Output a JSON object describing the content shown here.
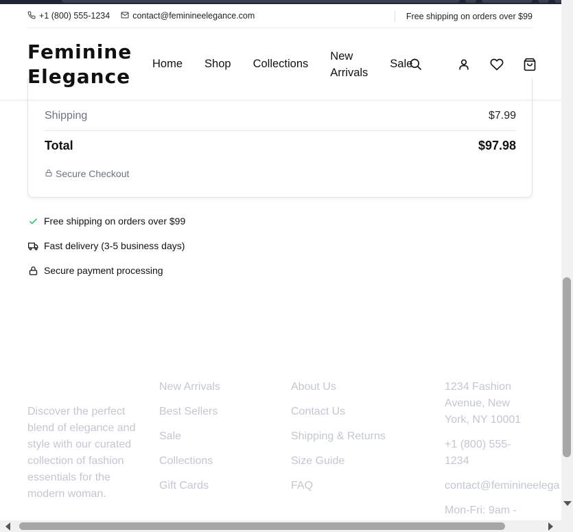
{
  "topbar": {
    "phone": "+1 (800) 555-1234",
    "email": "contact@feminineelegance.com",
    "promo": "Free shipping on orders over $99"
  },
  "header": {
    "logo_line1": "Feminine",
    "logo_line2": "Elegance",
    "nav": {
      "home": "Home",
      "shop": "Shop",
      "collections": "Collections",
      "new_line1": "New",
      "new_line2": "Arrivals",
      "sale": "Sale"
    },
    "icons": [
      "search-icon",
      "user-icon",
      "heart-icon",
      "cart-icon"
    ]
  },
  "summary": {
    "shipping_label": "Shipping",
    "shipping_value": "$7.99",
    "total_label": "Total",
    "total_value": "$97.98",
    "secure_label": "Secure Checkout"
  },
  "benefits": [
    {
      "icon": "check-icon",
      "text": "Free shipping on orders over $99"
    },
    {
      "icon": "truck-icon",
      "text": "Fast delivery (3-5 business days)"
    },
    {
      "icon": "lock-icon",
      "text": "Secure payment processing"
    }
  ],
  "footer": {
    "about": "Discover the perfect blend of elegance and style with our curated collection of fashion essentials for the modern woman.",
    "shop_links": [
      "New Arrivals",
      "Best Sellers",
      "Sale",
      "Collections",
      "Gift Cards"
    ],
    "help_links": [
      "About Us",
      "Contact Us",
      "Shipping & Returns",
      "Size Guide",
      "FAQ"
    ],
    "contact": {
      "address": "1234 Fashion Avenue, New York, NY 10001",
      "phone": "+1 (800) 555-1234",
      "email": "contact@feminineelega",
      "hours": "Mon-Fri: 9am -"
    }
  },
  "colors": {
    "accent_check": "#22c55e",
    "muted_text": "#6b7280",
    "footer_text": "#c3c7cf"
  }
}
